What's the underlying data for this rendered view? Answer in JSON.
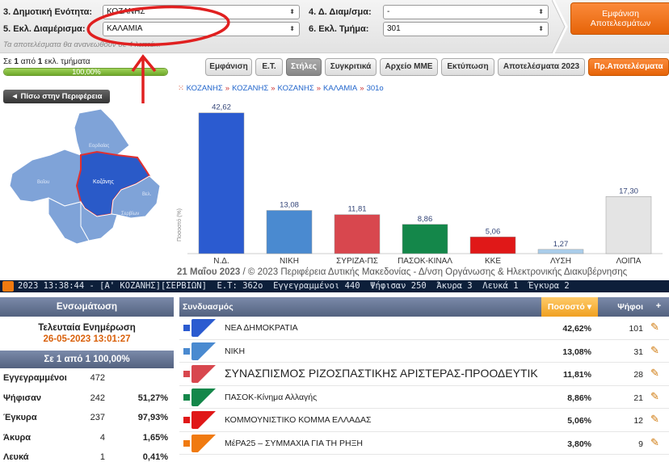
{
  "filters": {
    "municipal_unit": {
      "label": "3. Δημοτική Ενότητα:",
      "value": "ΚΟΖΑΝΗΣ"
    },
    "district": {
      "label": "5. Εκλ. Διαμέρισμα:",
      "value": "ΚΑΛΑΜΙΑ"
    },
    "local_community": {
      "label": "4. Δ. Διαμ/σμα:",
      "value": "-"
    },
    "polling_station": {
      "label": "6. Εκλ. Τμήμα:",
      "value": "301"
    },
    "notice": "Τα αποτελέσματα θα ανανεωθούν σε 4 λεπτά...",
    "show_results_label_1": "Εμφάνιση",
    "show_results_label_2": "Αποτελεσμάτων"
  },
  "status": {
    "text_prefix": "Σε",
    "counted": "1",
    "text_mid": "από",
    "total": "1",
    "text_suffix": "εκλ. τμήματα",
    "progress_label": "100,00%",
    "progress_fraction": 1.0
  },
  "tabs": [
    {
      "label": "Εμφάνιση",
      "active": false
    },
    {
      "label": "Ε.Τ.",
      "active": false
    },
    {
      "label": "Στήλες",
      "active": true
    },
    {
      "label": "Συγκριτικά",
      "active": false
    },
    {
      "label": "Αρχείο ΜΜΕ",
      "active": false
    },
    {
      "label": "Εκτύπωση",
      "active": false
    },
    {
      "label": "Αποτελέσματα 2023",
      "active": false
    },
    {
      "label": "Πρ.Αποτελέσματα",
      "active": false
    }
  ],
  "back_button": "◄ Πίσω στην Περιφέρεια",
  "map": {
    "labels": [
      "Εορδαίας",
      "Βοΐου",
      "Κοζάνης",
      "Σερβίων",
      "Βελ."
    ],
    "highlight_color": "#2a5ac8",
    "base_color": "#7fa3d8"
  },
  "breadcrumb": [
    "ΚΟΖΑΝΗΣ",
    "ΚΟΖΑΝΗΣ",
    "ΚΟΖΑΝΗΣ",
    "ΚΑΛΑΜΙΑ",
    "301ο"
  ],
  "chart_data": {
    "type": "bar",
    "categories": [
      "Ν.Δ.",
      "ΝΙΚΗ",
      "ΣΥΡΙΖΑ-ΠΣ",
      "ΠΑΣΟΚ-ΚΙΝΑΛ",
      "ΚΚΕ",
      "ΛΥΣΗ",
      "ΛΟΙΠΑ"
    ],
    "values": [
      42.62,
      13.08,
      11.81,
      8.86,
      5.06,
      1.27,
      17.3
    ],
    "value_labels": [
      "42,62",
      "13,08",
      "11,81",
      "8,86",
      "5,06",
      "1,27",
      "17,30"
    ],
    "colors": [
      "#2b5bd0",
      "#4a8ad0",
      "#d8474e",
      "#14874a",
      "#e01818",
      "#aacdea",
      "#e4e4e4"
    ],
    "ylabel": "Ποσοστό (%)",
    "ylim": [
      0,
      45
    ],
    "grid": false
  },
  "footer": {
    "date": "21 Μαΐου 2023",
    "text": " / © 2023 Περιφέρεια Δυτικής Μακεδονίας - Δ/νση Οργάνωσης & Ηλεκτρονικής Διακυβέρνησης"
  },
  "ticker": "2023 13:38:44 - [Α' ΚΟΖΑΝΗΣ][ΣΕΡΒΙΩΝ]  Ε.Τ: 362ο  Εγγεγραμμένοι 440  Ψήφισαν 250  Άκυρα 3  Λευκά 1  Έγκυρα 2",
  "integration": {
    "header": "Ενσωμάτωση",
    "last_update_label": "Τελευταία Ενημέρωση",
    "last_update": "26-05-2023 13:01:27",
    "count": "Σε 1 από  1   100,00%",
    "stats": [
      {
        "label": "Εγγεγραμμένοι",
        "value": "472",
        "pct": ""
      },
      {
        "label": "Ψήφισαν",
        "value": "242",
        "pct": "51,27%"
      },
      {
        "label": "Έγκυρα",
        "value": "237",
        "pct": "97,93%"
      },
      {
        "label": "Άκυρα",
        "value": "4",
        "pct": "1,65%"
      },
      {
        "label": "Λευκά",
        "value": "1",
        "pct": "0,41%"
      }
    ]
  },
  "results": {
    "headers": {
      "party": "Συνδυασμός",
      "percent": "Ποσοστό",
      "votes": "Ψήφοι",
      "plus": "+"
    },
    "rows": [
      {
        "name": "ΝΕΑ ΔΗΜΟΚΡΑΤΙΑ",
        "percent": "42,62%",
        "votes": "101",
        "color": "#2b5bd0",
        "big": false
      },
      {
        "name": "ΝΙΚΗ",
        "percent": "13,08%",
        "votes": "31",
        "color": "#4a8ad0",
        "big": false
      },
      {
        "name": "ΣΥΝΑΣΠΙΣΜΟΣ ΡΙΖΟΣΠΑΣΤΙΚΗΣ ΑΡΙΣΤΕΡΑΣ-ΠΡΟΟΔΕΥΤΙΚΗ ΣΥΜΜΑΧΙΑ",
        "percent": "11,81%",
        "votes": "28",
        "color": "#d8474e",
        "big": true
      },
      {
        "name": "ΠΑΣΟΚ-Κίνημα Αλλαγής",
        "percent": "8,86%",
        "votes": "21",
        "color": "#14874a",
        "big": false
      },
      {
        "name": "ΚΟΜΜΟΥΝΙΣΤΙΚΟ ΚΟΜΜΑ ΕΛΛΑΔΑΣ",
        "percent": "5,06%",
        "votes": "12",
        "color": "#e01818",
        "big": false
      },
      {
        "name": "ΜέΡΑ25 – ΣΥΜΜΑΧΙΑ ΓΙΑ ΤΗ ΡΗΞΗ",
        "percent": "3,80%",
        "votes": "9",
        "color": "#f07a10",
        "big": false
      }
    ]
  }
}
